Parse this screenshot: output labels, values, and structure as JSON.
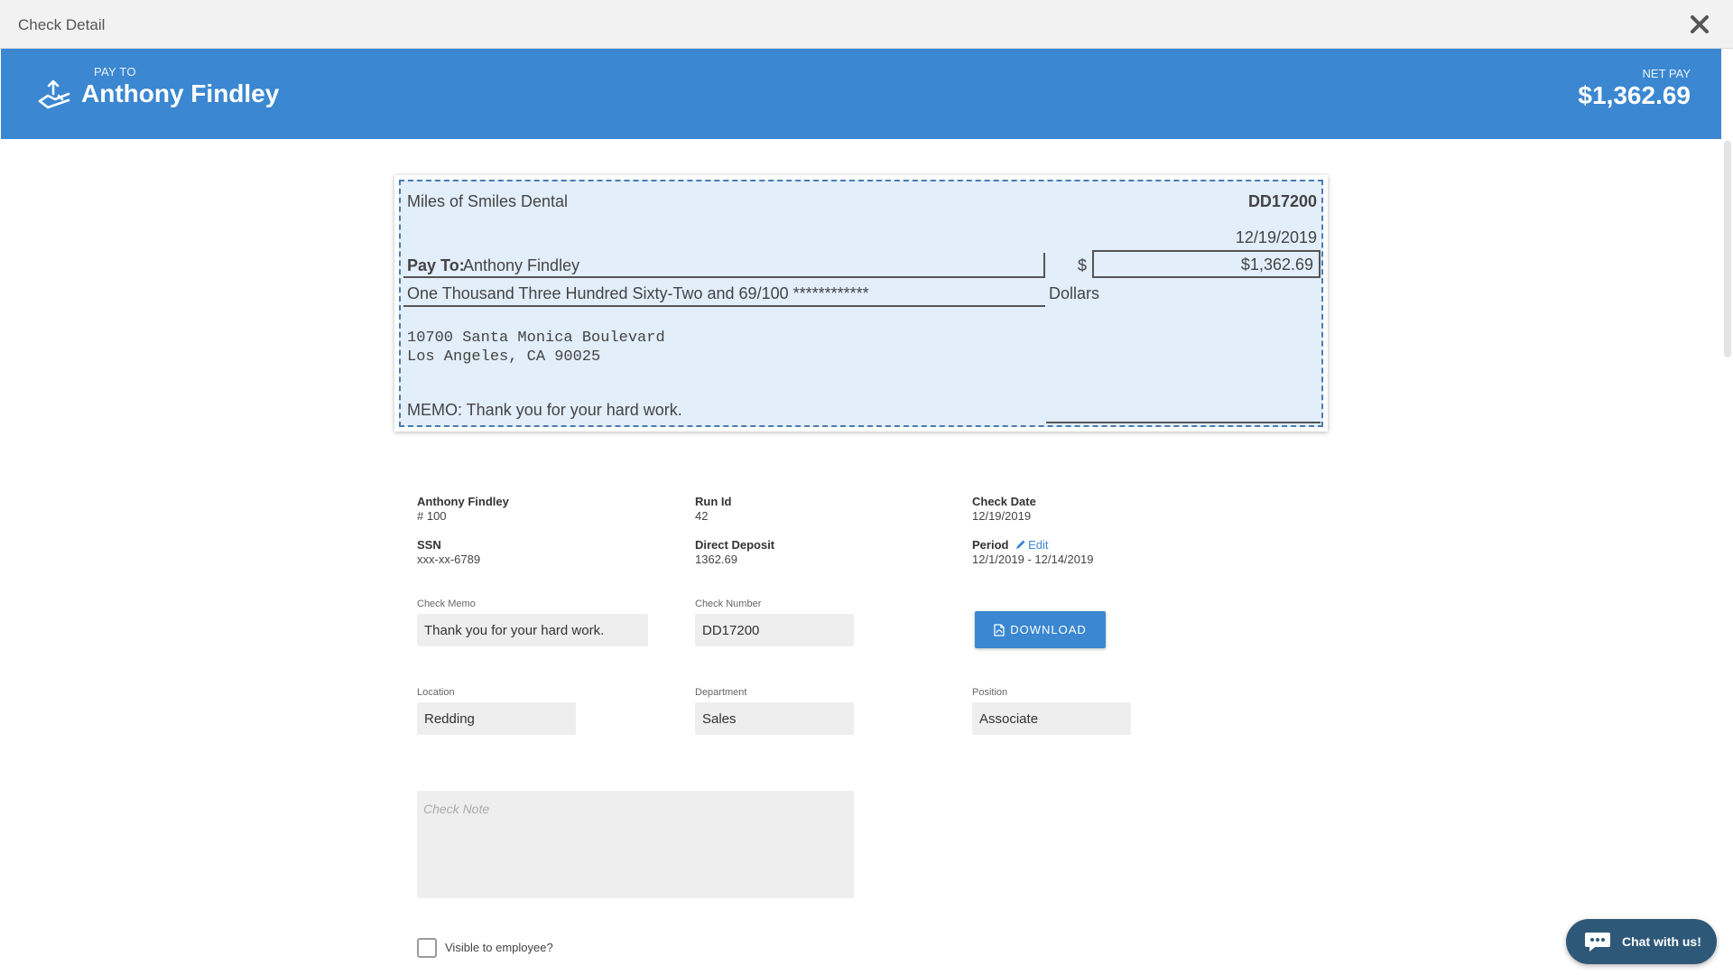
{
  "window": {
    "title": "Check Detail"
  },
  "header": {
    "payto_label": "PAY TO",
    "payto_name": "Anthony Findley",
    "netpay_label": "NET PAY",
    "netpay_value": "$1,362.69"
  },
  "check": {
    "company": "Miles of Smiles Dental",
    "number": "DD17200",
    "date": "12/19/2019",
    "payto_label": "Pay To:",
    "payto_name": "Anthony Findley",
    "dollar_sign": "$",
    "amount": "$1,362.69",
    "amount_words": "One Thousand Three Hundred Sixty-Two and 69/100 ************",
    "dollars_label": "Dollars",
    "address_line1": "10700 Santa Monica Boulevard",
    "address_line2": "Los Angeles, CA 90025",
    "memo": "MEMO: Thank you for your hard work."
  },
  "details": {
    "employee_name": "Anthony Findley",
    "employee_number": "# 100",
    "run_id_label": "Run Id",
    "run_id": "42",
    "check_date_label": "Check Date",
    "check_date": "12/19/2019",
    "ssn_label": "SSN",
    "ssn": "xxx-xx-6789",
    "direct_deposit_label": "Direct Deposit",
    "direct_deposit": "1362.69",
    "period_label": "Period",
    "period_edit": "Edit",
    "period": "12/1/2019 - 12/14/2019"
  },
  "form": {
    "check_memo_label": "Check Memo",
    "check_memo": "Thank you for your hard work.",
    "check_number_label": "Check Number",
    "check_number": "DD17200",
    "download_label": "DOWNLOAD",
    "location_label": "Location",
    "location": "Redding",
    "department_label": "Department",
    "department": "Sales",
    "position_label": "Position",
    "position": "Associate",
    "check_note_placeholder": "Check Note",
    "visible_label": "Visible to employee?"
  },
  "chat": {
    "label": "Chat with us!"
  },
  "colors": {
    "header_blue": "#3b87d1",
    "check_bg": "#e2eefa",
    "chat_bg": "#2e5877"
  },
  "icons": [
    "close-icon",
    "pay-hand-icon",
    "pencil-icon",
    "pdf-file-icon",
    "chat-bubble-icon"
  ]
}
